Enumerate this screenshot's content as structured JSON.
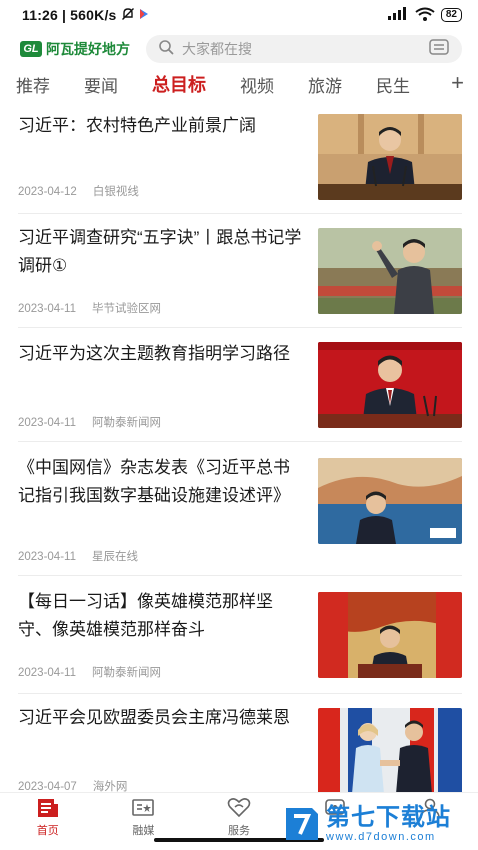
{
  "status_bar": {
    "time": "11:26",
    "network_speed": "560K/s",
    "battery": "82"
  },
  "header": {
    "logo_mark": "GL",
    "logo_text": "阿瓦提好地方",
    "search_placeholder": "大家都在搜"
  },
  "tabs": [
    {
      "label": "推荐",
      "active": false
    },
    {
      "label": "要闻",
      "active": false
    },
    {
      "label": "总目标",
      "active": true
    },
    {
      "label": "视频",
      "active": false
    },
    {
      "label": "旅游",
      "active": false
    },
    {
      "label": "民生",
      "active": false
    }
  ],
  "tab_add_label": "+",
  "news": [
    {
      "title": "习近平：农村特色产业前景广阔",
      "date": "2023-04-12",
      "source": "白银视线"
    },
    {
      "title": "习近平调查研究“五字诀”丨跟总书记学调研①",
      "date": "2023-04-11",
      "source": "毕节试验区网"
    },
    {
      "title": "习近平为这次主题教育指明学习路径",
      "date": "2023-04-11",
      "source": "阿勒泰新闻网"
    },
    {
      "title": "《中国网信》杂志发表《习近平总书记指引我国数字基础设施建设述评》",
      "date": "2023-04-11",
      "source": "星辰在线"
    },
    {
      "title": "【每日一习话】像英雄模范那样坚守、像英雄模范那样奋斗",
      "date": "2023-04-11",
      "source": "阿勒泰新闻网"
    },
    {
      "title": "习近平会见欧盟委员会主席冯德莱恩",
      "date": "2023-04-07",
      "source": "海外网"
    }
  ],
  "bottom_nav": [
    {
      "label": "首页",
      "icon": "home-news-icon",
      "active": true
    },
    {
      "label": "融媒",
      "icon": "media-icon",
      "active": false
    },
    {
      "label": "服务",
      "icon": "service-heart-icon",
      "active": false
    },
    {
      "label": "",
      "icon": "chat-icon",
      "active": false
    },
    {
      "label": "",
      "icon": "profile-icon",
      "active": false
    }
  ],
  "watermark": {
    "name": "第七下载站",
    "url": "www.d7down.com"
  },
  "colors": {
    "accent": "#cc1f1f",
    "brand_green": "#1e8a3a",
    "watermark_blue": "#1c7fd6"
  }
}
